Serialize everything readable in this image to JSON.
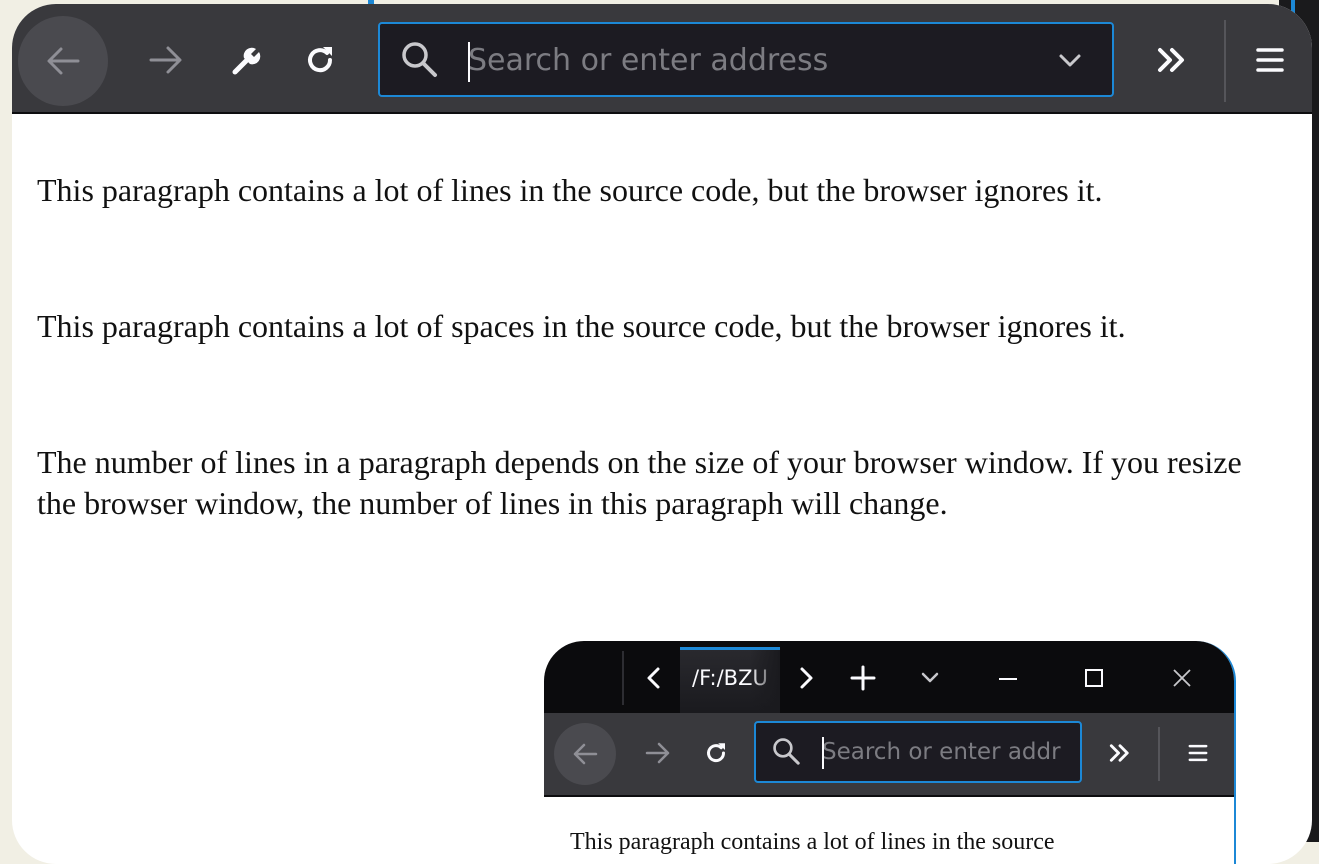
{
  "toolbar": {
    "back_icon": "arrow-left-icon",
    "forward_icon": "arrow-right-icon",
    "customize_icon": "wrench-icon",
    "reload_icon": "reload-icon",
    "search_icon": "search-icon",
    "dropdown_icon": "chevron-down-icon",
    "overflow_icon": "double-chevron-right-icon",
    "menu_icon": "hamburger-menu-icon",
    "url_placeholder": "Search or enter address",
    "url_value": ""
  },
  "content": {
    "paragraphs": [
      "This paragraph contains a lot of lines in the source code, but the browser ignores it.",
      "This paragraph contains a lot of spaces in the source code, but the browser ignores it.",
      "The number of lines in a paragraph depends on the size of your browser window. If you resize the browser window, the number of lines in this paragraph will change."
    ]
  },
  "mini_window": {
    "tab_title": "/F:/BZU",
    "url_placeholder": "Search or enter addr",
    "content_text": "This paragraph contains a lot of lines in the source"
  },
  "colors": {
    "toolbar_bg": "#39393d",
    "accent": "#1c88d6",
    "url_bg": "#1c1b22",
    "page_bg": "#f1efe4"
  }
}
